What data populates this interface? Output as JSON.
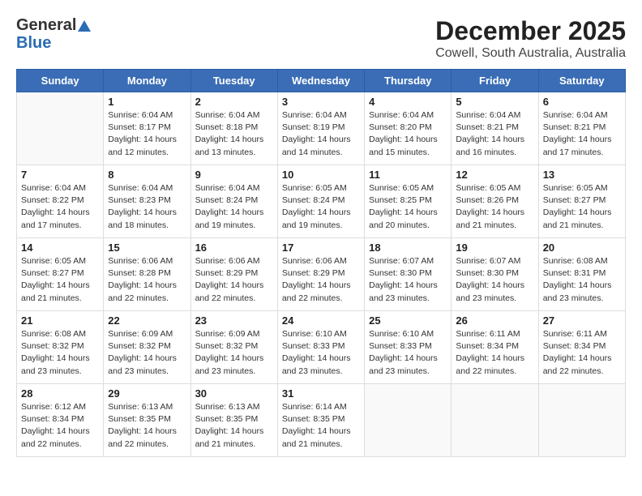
{
  "logo": {
    "general": "General",
    "blue": "Blue"
  },
  "title": "December 2025",
  "subtitle": "Cowell, South Australia, Australia",
  "weekdays": [
    "Sunday",
    "Monday",
    "Tuesday",
    "Wednesday",
    "Thursday",
    "Friday",
    "Saturday"
  ],
  "weeks": [
    [
      {
        "day": "",
        "info": ""
      },
      {
        "day": "1",
        "info": "Sunrise: 6:04 AM\nSunset: 8:17 PM\nDaylight: 14 hours\nand 12 minutes."
      },
      {
        "day": "2",
        "info": "Sunrise: 6:04 AM\nSunset: 8:18 PM\nDaylight: 14 hours\nand 13 minutes."
      },
      {
        "day": "3",
        "info": "Sunrise: 6:04 AM\nSunset: 8:19 PM\nDaylight: 14 hours\nand 14 minutes."
      },
      {
        "day": "4",
        "info": "Sunrise: 6:04 AM\nSunset: 8:20 PM\nDaylight: 14 hours\nand 15 minutes."
      },
      {
        "day": "5",
        "info": "Sunrise: 6:04 AM\nSunset: 8:21 PM\nDaylight: 14 hours\nand 16 minutes."
      },
      {
        "day": "6",
        "info": "Sunrise: 6:04 AM\nSunset: 8:21 PM\nDaylight: 14 hours\nand 17 minutes."
      }
    ],
    [
      {
        "day": "7",
        "info": "Sunrise: 6:04 AM\nSunset: 8:22 PM\nDaylight: 14 hours\nand 17 minutes."
      },
      {
        "day": "8",
        "info": "Sunrise: 6:04 AM\nSunset: 8:23 PM\nDaylight: 14 hours\nand 18 minutes."
      },
      {
        "day": "9",
        "info": "Sunrise: 6:04 AM\nSunset: 8:24 PM\nDaylight: 14 hours\nand 19 minutes."
      },
      {
        "day": "10",
        "info": "Sunrise: 6:05 AM\nSunset: 8:24 PM\nDaylight: 14 hours\nand 19 minutes."
      },
      {
        "day": "11",
        "info": "Sunrise: 6:05 AM\nSunset: 8:25 PM\nDaylight: 14 hours\nand 20 minutes."
      },
      {
        "day": "12",
        "info": "Sunrise: 6:05 AM\nSunset: 8:26 PM\nDaylight: 14 hours\nand 21 minutes."
      },
      {
        "day": "13",
        "info": "Sunrise: 6:05 AM\nSunset: 8:27 PM\nDaylight: 14 hours\nand 21 minutes."
      }
    ],
    [
      {
        "day": "14",
        "info": "Sunrise: 6:05 AM\nSunset: 8:27 PM\nDaylight: 14 hours\nand 21 minutes."
      },
      {
        "day": "15",
        "info": "Sunrise: 6:06 AM\nSunset: 8:28 PM\nDaylight: 14 hours\nand 22 minutes."
      },
      {
        "day": "16",
        "info": "Sunrise: 6:06 AM\nSunset: 8:29 PM\nDaylight: 14 hours\nand 22 minutes."
      },
      {
        "day": "17",
        "info": "Sunrise: 6:06 AM\nSunset: 8:29 PM\nDaylight: 14 hours\nand 22 minutes."
      },
      {
        "day": "18",
        "info": "Sunrise: 6:07 AM\nSunset: 8:30 PM\nDaylight: 14 hours\nand 23 minutes."
      },
      {
        "day": "19",
        "info": "Sunrise: 6:07 AM\nSunset: 8:30 PM\nDaylight: 14 hours\nand 23 minutes."
      },
      {
        "day": "20",
        "info": "Sunrise: 6:08 AM\nSunset: 8:31 PM\nDaylight: 14 hours\nand 23 minutes."
      }
    ],
    [
      {
        "day": "21",
        "info": "Sunrise: 6:08 AM\nSunset: 8:32 PM\nDaylight: 14 hours\nand 23 minutes."
      },
      {
        "day": "22",
        "info": "Sunrise: 6:09 AM\nSunset: 8:32 PM\nDaylight: 14 hours\nand 23 minutes."
      },
      {
        "day": "23",
        "info": "Sunrise: 6:09 AM\nSunset: 8:32 PM\nDaylight: 14 hours\nand 23 minutes."
      },
      {
        "day": "24",
        "info": "Sunrise: 6:10 AM\nSunset: 8:33 PM\nDaylight: 14 hours\nand 23 minutes."
      },
      {
        "day": "25",
        "info": "Sunrise: 6:10 AM\nSunset: 8:33 PM\nDaylight: 14 hours\nand 23 minutes."
      },
      {
        "day": "26",
        "info": "Sunrise: 6:11 AM\nSunset: 8:34 PM\nDaylight: 14 hours\nand 22 minutes."
      },
      {
        "day": "27",
        "info": "Sunrise: 6:11 AM\nSunset: 8:34 PM\nDaylight: 14 hours\nand 22 minutes."
      }
    ],
    [
      {
        "day": "28",
        "info": "Sunrise: 6:12 AM\nSunset: 8:34 PM\nDaylight: 14 hours\nand 22 minutes."
      },
      {
        "day": "29",
        "info": "Sunrise: 6:13 AM\nSunset: 8:35 PM\nDaylight: 14 hours\nand 22 minutes."
      },
      {
        "day": "30",
        "info": "Sunrise: 6:13 AM\nSunset: 8:35 PM\nDaylight: 14 hours\nand 21 minutes."
      },
      {
        "day": "31",
        "info": "Sunrise: 6:14 AM\nSunset: 8:35 PM\nDaylight: 14 hours\nand 21 minutes."
      },
      {
        "day": "",
        "info": ""
      },
      {
        "day": "",
        "info": ""
      },
      {
        "day": "",
        "info": ""
      }
    ]
  ]
}
